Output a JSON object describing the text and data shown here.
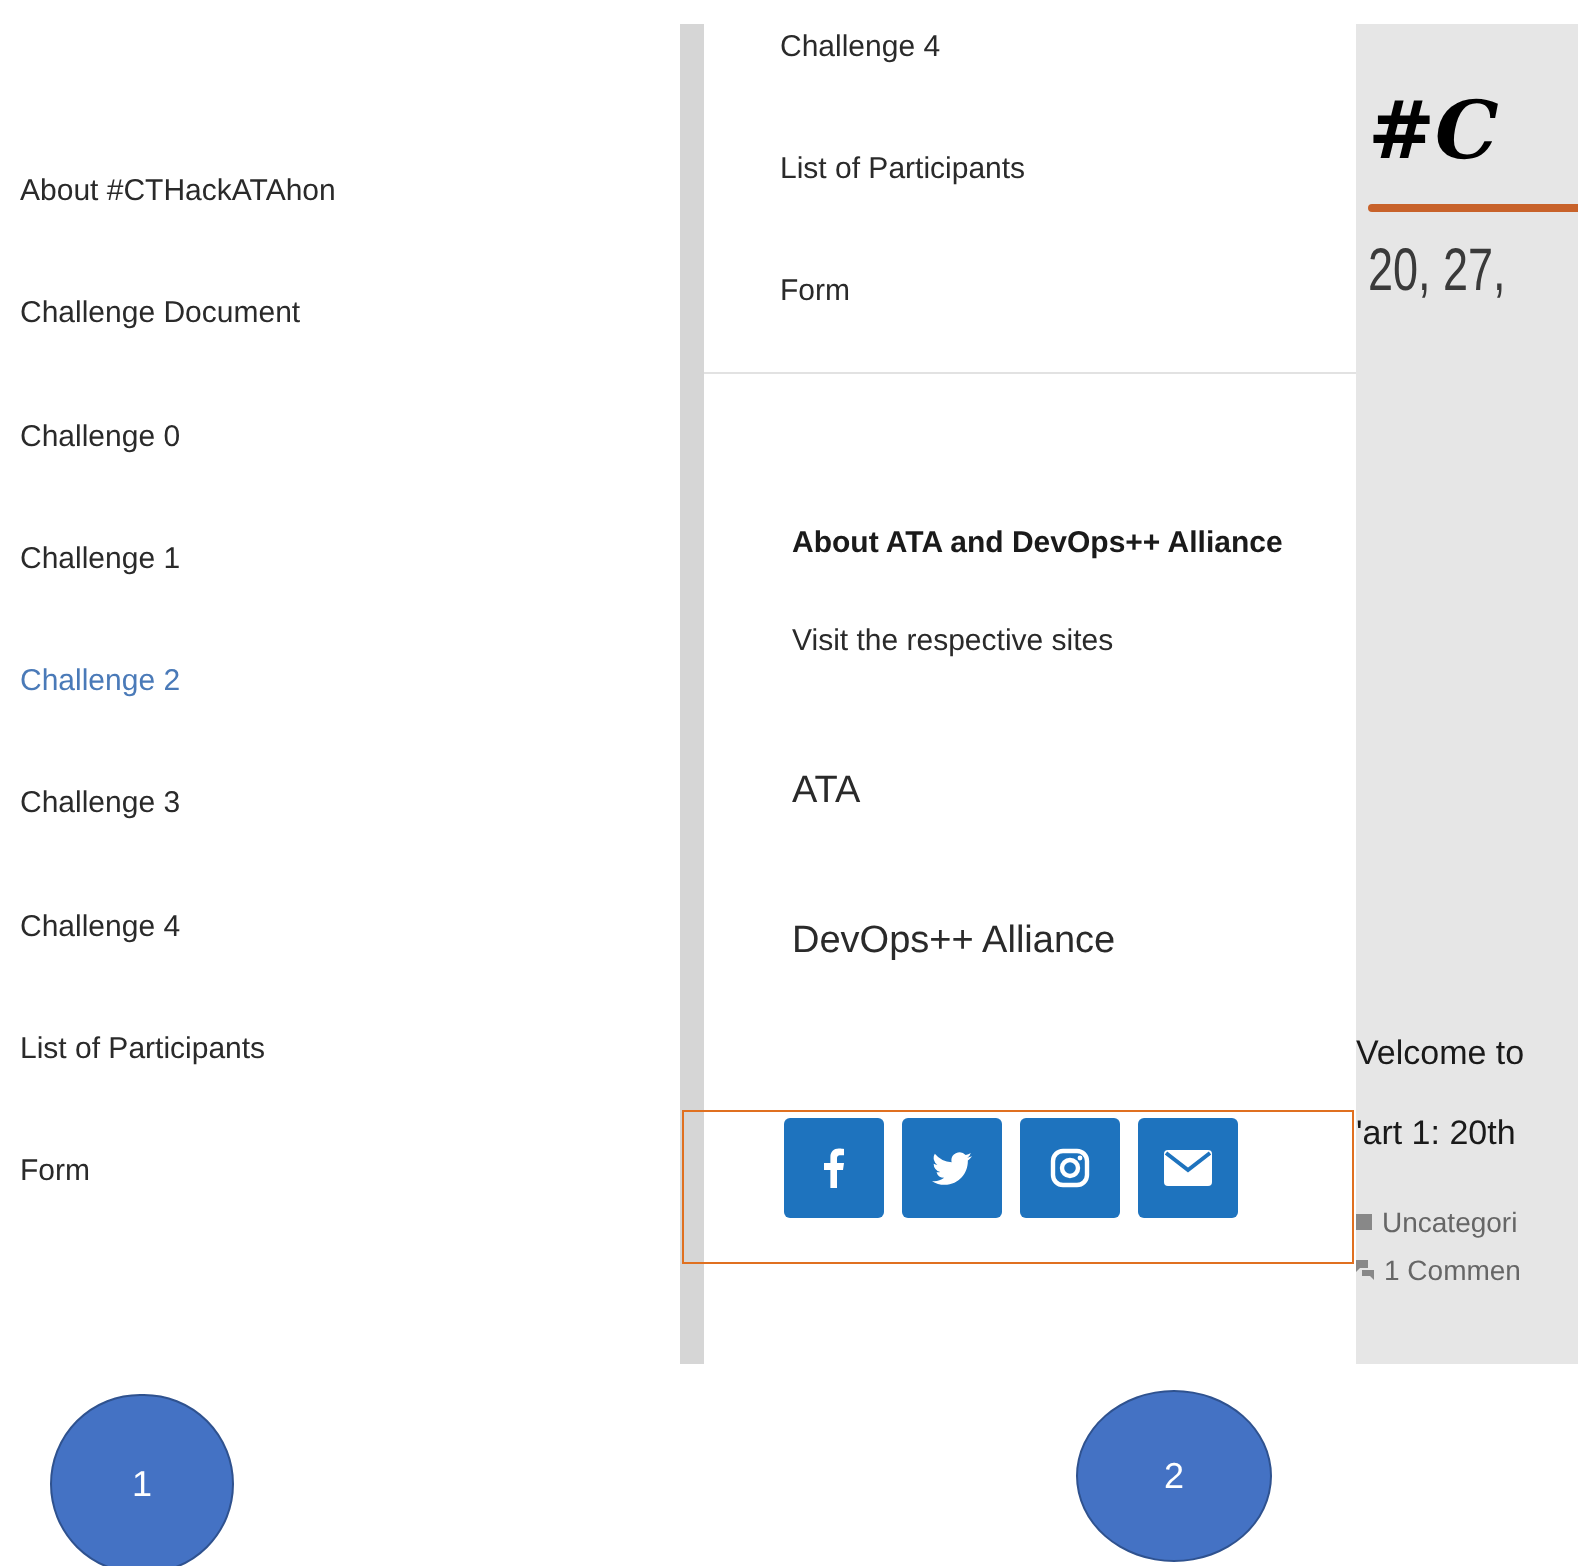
{
  "panel_1": {
    "menu": [
      {
        "label": "About #CTHackATAhon",
        "selected": false
      },
      {
        "label": "Challenge Document",
        "selected": false
      },
      {
        "label": "Challenge 0",
        "selected": false
      },
      {
        "label": "Challenge 1",
        "selected": false
      },
      {
        "label": "Challenge 2",
        "selected": true
      },
      {
        "label": "Challenge 3",
        "selected": false
      },
      {
        "label": "Challenge 4",
        "selected": false
      },
      {
        "label": "List of Participants",
        "selected": false
      },
      {
        "label": "Form",
        "selected": false
      }
    ],
    "callout": "1"
  },
  "panel_2": {
    "menu": [
      "Challenge 4",
      "List of Participants",
      "Form"
    ],
    "widget": {
      "heading": "About ATA and DevOps++ Alliance",
      "text": "Visit the respective sites",
      "links": [
        "ATA",
        "DevOps++ Alliance"
      ]
    },
    "social": [
      {
        "kind": "facebook"
      },
      {
        "kind": "twitter"
      },
      {
        "kind": "instagram"
      },
      {
        "kind": "email"
      }
    ],
    "banner": {
      "title": "#C",
      "dates": "20, 27,"
    },
    "post": {
      "lines": [
        "Velcome to",
        "'art 1: 20th"
      ],
      "category": "Uncategori",
      "comments": "1 Commen"
    },
    "callout": "2"
  }
}
